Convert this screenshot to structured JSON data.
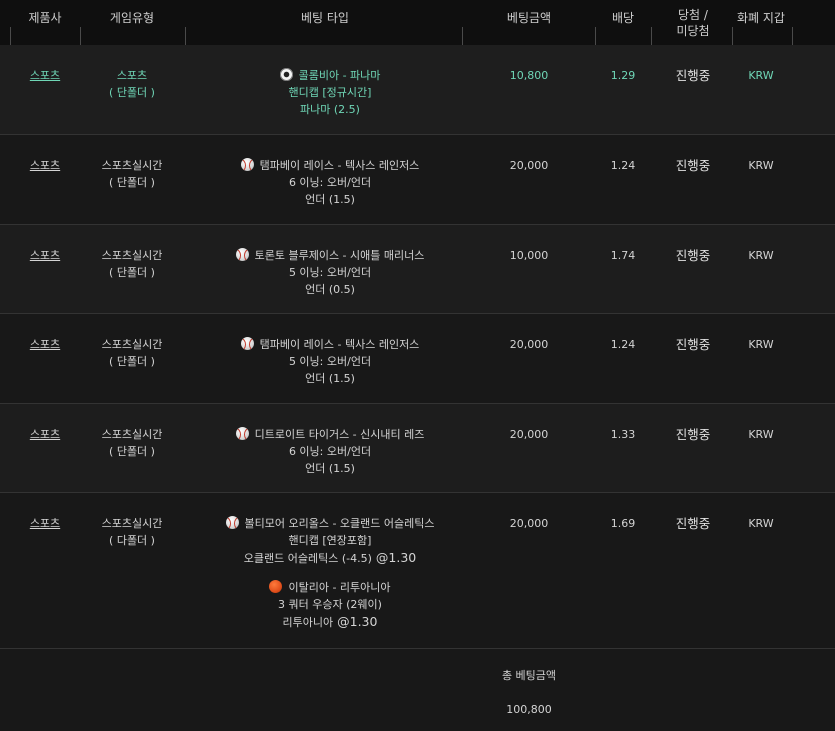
{
  "header": {
    "columns": [
      {
        "label": "제품사"
      },
      {
        "label": "게임유형"
      },
      {
        "label": "베팅 타입"
      },
      {
        "label": "베팅금액"
      },
      {
        "label": "배당"
      },
      {
        "label": "당첨 /",
        "label2": "미당첨"
      },
      {
        "label": "화폐 지갑"
      }
    ]
  },
  "rows": [
    {
      "product": "스포츠",
      "game_type": "스포츠",
      "bet_mode": "( 단폴더 )",
      "picks": [
        {
          "icon": "soccer-ball-icon",
          "match": "콜롬비아 - 파나마",
          "market": "핸디캡 [정규시간]",
          "selection": "파나마 (2.5)",
          "odds": ""
        }
      ],
      "amount": "10,800",
      "odds": "1.29",
      "result": "진행중",
      "currency": "KRW",
      "highlight": true
    },
    {
      "product": "스포츠",
      "game_type": "스포츠실시간",
      "bet_mode": "( 단폴더 )",
      "picks": [
        {
          "icon": "baseball-icon",
          "match": "탬파베이 레이스 - 텍사스 레인저스",
          "market": "6 이닝: 오버/언더",
          "selection": "언더 (1.5)",
          "odds": ""
        }
      ],
      "amount": "20,000",
      "odds": "1.24",
      "result": "진행중",
      "currency": "KRW"
    },
    {
      "product": "스포츠",
      "game_type": "스포츠실시간",
      "bet_mode": "( 단폴더 )",
      "picks": [
        {
          "icon": "baseball-icon",
          "match": "토론토 블루제이스 - 시애틀 매리너스",
          "market": "5 이닝: 오버/언더",
          "selection": "언더 (0.5)",
          "odds": ""
        }
      ],
      "amount": "10,000",
      "odds": "1.74",
      "result": "진행중",
      "currency": "KRW"
    },
    {
      "product": "스포츠",
      "game_type": "스포츠실시간",
      "bet_mode": "( 단폴더 )",
      "picks": [
        {
          "icon": "baseball-icon",
          "match": "탬파베이 레이스 - 텍사스 레인저스",
          "market": "5 이닝: 오버/언더",
          "selection": "언더 (1.5)",
          "odds": ""
        }
      ],
      "amount": "20,000",
      "odds": "1.24",
      "result": "진행중",
      "currency": "KRW"
    },
    {
      "product": "스포츠",
      "game_type": "스포츠실시간",
      "bet_mode": "( 단폴더 )",
      "picks": [
        {
          "icon": "baseball-icon",
          "match": "디트로이트 타이거스 - 신시내티 레즈",
          "market": "6 이닝: 오버/언더",
          "selection": "언더 (1.5)",
          "odds": ""
        }
      ],
      "amount": "20,000",
      "odds": "1.33",
      "result": "진행중",
      "currency": "KRW"
    },
    {
      "product": "스포츠",
      "game_type": "스포츠실시간",
      "bet_mode": "( 다폴더 )",
      "picks": [
        {
          "icon": "baseball-icon",
          "match": "볼티모어 오리올스 - 오클랜드 어슬레틱스",
          "market": "핸디캡 [연장포함]",
          "selection": "오클랜드 어슬레틱스 (-4.5)",
          "odds": "@1.30"
        },
        {
          "icon": "basketball-icon",
          "match": "이탈리아 - 리투아니아",
          "market": "3 쿼터 우승자 (2웨이)",
          "selection": "리투아니아",
          "odds": "@1.30"
        }
      ],
      "amount": "20,000",
      "odds": "1.69",
      "result": "진행중",
      "currency": "KRW"
    }
  ],
  "footer": {
    "total_label": "총 베팅금액",
    "total_value": "100,800"
  },
  "colors": {
    "background": "#161616",
    "header_bg": "#0f0f0f",
    "accent_teal": "#6fd6b6",
    "text": "#d4d4d4"
  }
}
